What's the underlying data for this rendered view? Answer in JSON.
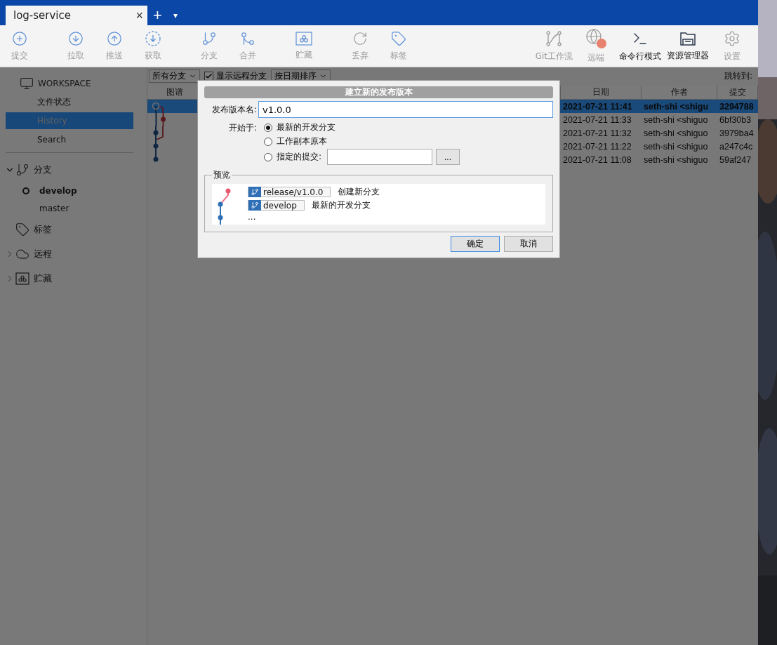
{
  "tab": {
    "title": "log-service",
    "close": "×",
    "add": "+",
    "menu": "▾"
  },
  "toolbar": {
    "groups": [
      {
        "items": [
          {
            "label": "提交",
            "disabled": true
          }
        ]
      },
      {
        "items": [
          {
            "label": "拉取",
            "disabled": true
          },
          {
            "label": "推送",
            "disabled": true
          },
          {
            "label": "获取",
            "disabled": true
          }
        ]
      },
      {
        "items": [
          {
            "label": "分支",
            "disabled": true
          },
          {
            "label": "合并",
            "disabled": true
          }
        ]
      },
      {
        "items": [
          {
            "label": "贮藏",
            "disabled": true
          }
        ]
      },
      {
        "items": [
          {
            "label": "丢弃",
            "disabled": true
          },
          {
            "label": "标签",
            "disabled": true
          }
        ]
      }
    ],
    "right_items": [
      {
        "label": "Git工作流",
        "disabled": true
      },
      {
        "label": "远端",
        "disabled": true
      },
      {
        "label": "命令行模式",
        "disabled": false
      },
      {
        "label": "资源管理器",
        "disabled": false
      },
      {
        "label": "设置",
        "disabled": true
      }
    ]
  },
  "sidebar": {
    "workspace": {
      "title": "WORKSPACE",
      "items": [
        {
          "label": "文件状态",
          "selected": false
        },
        {
          "label": "History",
          "selected": true
        },
        {
          "label": "Search",
          "selected": false
        }
      ]
    },
    "sections": [
      {
        "label": "分支",
        "expanded": true,
        "children": [
          {
            "label": "develop",
            "current": true
          },
          {
            "label": "master",
            "current": false
          }
        ]
      },
      {
        "label": "标签"
      },
      {
        "label": "远程",
        "expanded": false
      },
      {
        "label": "贮藏",
        "expanded": false
      }
    ]
  },
  "filter_bar": {
    "branches": "所有分支",
    "show_remote": {
      "label": "显示远程分支",
      "checked": true
    },
    "sort": "按日期排序",
    "jump_to": "跳转到:"
  },
  "table": {
    "columns": [
      "图谱",
      "日期",
      "作者",
      "提交"
    ],
    "rows": [
      {
        "date": "2021-07-21 11:41",
        "author": "seth-shi <shigu",
        "commit": "3294788",
        "selected": true
      },
      {
        "date": "2021-07-21 11:33",
        "author": "seth-shi <shiguo",
        "commit": "6bf30b3",
        "selected": false
      },
      {
        "date": "2021-07-21 11:32",
        "author": "seth-shi <shiguo",
        "commit": "3979ba4",
        "selected": false
      },
      {
        "date": "2021-07-21 11:22",
        "author": "seth-shi <shiguo",
        "commit": "a247c4c",
        "selected": false
      },
      {
        "date": "2021-07-21 11:08",
        "author": "seth-shi <shiguo",
        "commit": "59af247",
        "selected": false
      }
    ]
  },
  "dialog": {
    "title": "建立新的发布版本",
    "name_label": "发布版本名:",
    "name_value": "v1.0.0",
    "name_focused": true,
    "start_label": "开始于:",
    "options": [
      {
        "label": "最新的开发分支",
        "selected": true
      },
      {
        "label": "工作副本原本",
        "selected": false
      },
      {
        "label": "指定的提交:",
        "selected": false
      }
    ],
    "browse": "...",
    "preview": {
      "title": "预览",
      "branches": [
        {
          "name": "release/v1.0.0",
          "note": "创建新分支"
        },
        {
          "name": "develop",
          "note": "最新的开发分支"
        }
      ],
      "more": "..."
    },
    "buttons": [
      {
        "label": "确定",
        "default": true
      },
      {
        "label": "取消",
        "default": false
      }
    ]
  }
}
